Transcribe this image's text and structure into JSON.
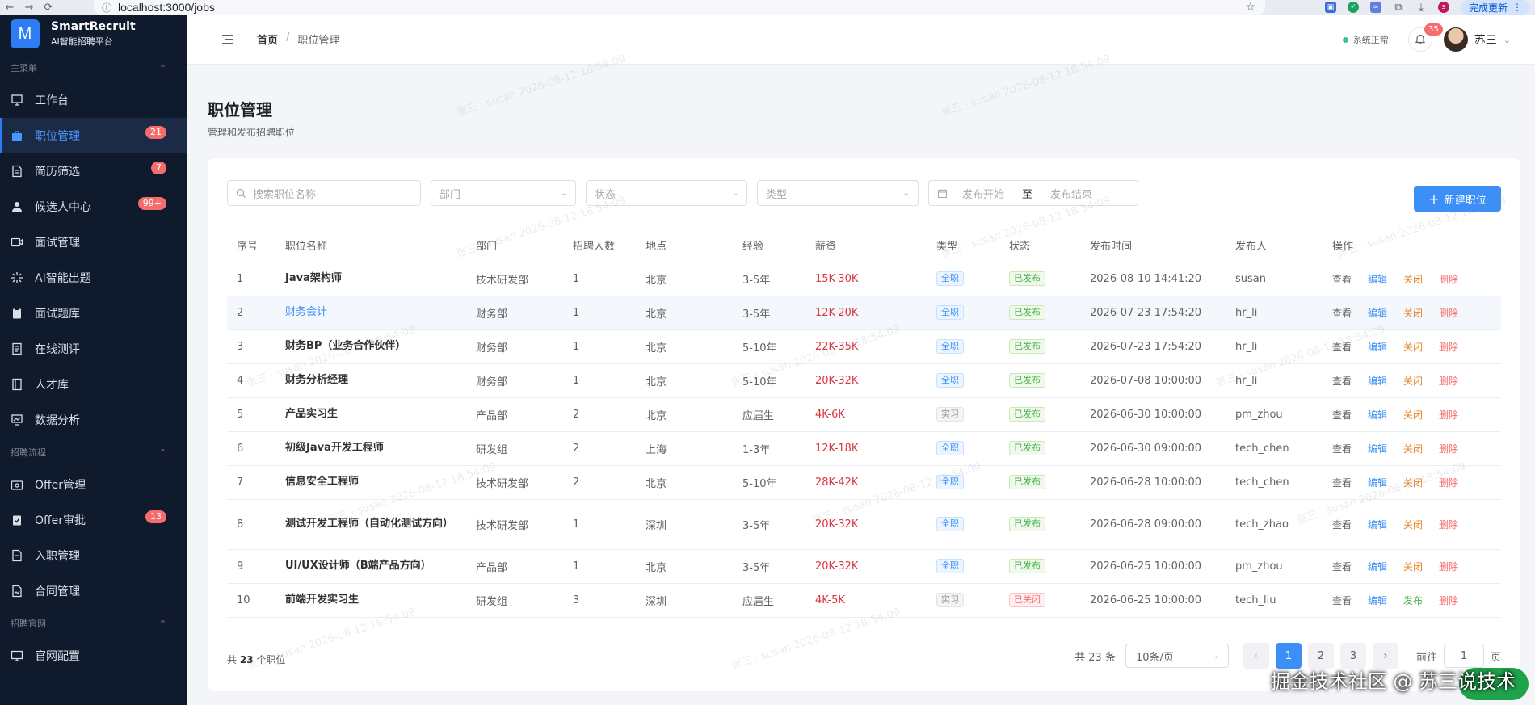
{
  "browser": {
    "url": "localhost:3000/jobs",
    "update_label": "完成更新",
    "profile_initial": "s"
  },
  "brand": {
    "name": "SmartRecruit",
    "subtitle": "AI智能招聘平台",
    "logo_letter": "M"
  },
  "sidebar": {
    "groups": [
      {
        "title": "主菜单",
        "items": [
          {
            "label": "工作台",
            "icon": "dashboard-icon"
          },
          {
            "label": "职位管理",
            "icon": "briefcase-icon",
            "badge": "21",
            "active": true
          },
          {
            "label": "简历筛选",
            "icon": "document-icon",
            "badge": "7"
          },
          {
            "label": "候选人中心",
            "icon": "user-icon",
            "badge": "99+"
          },
          {
            "label": "面试管理",
            "icon": "video-icon"
          },
          {
            "label": "AI智能出题",
            "icon": "sparkle-icon"
          },
          {
            "label": "面试题库",
            "icon": "clipboard-icon"
          },
          {
            "label": "在线测评",
            "icon": "test-icon"
          },
          {
            "label": "人才库",
            "icon": "book-icon"
          },
          {
            "label": "数据分析",
            "icon": "chart-icon"
          }
        ]
      },
      {
        "title": "招聘流程",
        "items": [
          {
            "label": "Offer管理",
            "icon": "offer-icon"
          },
          {
            "label": "Offer审批",
            "icon": "approve-icon",
            "badge": "13"
          },
          {
            "label": "入职管理",
            "icon": "onboard-icon"
          },
          {
            "label": "合同管理",
            "icon": "contract-icon"
          }
        ]
      },
      {
        "title": "招聘官网",
        "items": [
          {
            "label": "官网配置",
            "icon": "monitor-icon"
          }
        ]
      }
    ]
  },
  "header": {
    "breadcrumb_home": "首页",
    "breadcrumb_sep": "/",
    "breadcrumb_current": "职位管理",
    "system_status": "系统正常",
    "notification_count": "35",
    "user_name": "苏三"
  },
  "page": {
    "title": "职位管理",
    "subtitle": "管理和发布招聘职位"
  },
  "filters": {
    "search_placeholder": "搜索职位名称",
    "department_placeholder": "部门",
    "status_placeholder": "状态",
    "type_placeholder": "类型",
    "date_start": "发布开始",
    "date_sep": "至",
    "date_end": "发布结束",
    "new_button": "新建职位"
  },
  "table": {
    "columns": [
      "序号",
      "职位名称",
      "部门",
      "招聘人数",
      "地点",
      "经验",
      "薪资",
      "类型",
      "状态",
      "发布时间",
      "发布人",
      "操作"
    ],
    "rows": [
      {
        "no": "1",
        "name": "Java架构师",
        "dept": "技术研发部",
        "count": "1",
        "loc": "北京",
        "exp": "3-5年",
        "salary": "15K-30K",
        "type": "全职",
        "status": "已发布",
        "time": "2026-08-10 14:41:20",
        "publisher": "susan",
        "toggle": "关闭"
      },
      {
        "no": "2",
        "name": "财务会计",
        "dept": "财务部",
        "count": "1",
        "loc": "北京",
        "exp": "3-5年",
        "salary": "12K-20K",
        "type": "全职",
        "status": "已发布",
        "time": "2026-07-23 17:54:20",
        "publisher": "hr_li",
        "toggle": "关闭"
      },
      {
        "no": "3",
        "name": "财务BP（业务合作伙伴）",
        "dept": "财务部",
        "count": "1",
        "loc": "北京",
        "exp": "5-10年",
        "salary": "22K-35K",
        "type": "全职",
        "status": "已发布",
        "time": "2026-07-23 17:54:20",
        "publisher": "hr_li",
        "toggle": "关闭"
      },
      {
        "no": "4",
        "name": "财务分析经理",
        "dept": "财务部",
        "count": "1",
        "loc": "北京",
        "exp": "5-10年",
        "salary": "20K-32K",
        "type": "全职",
        "status": "已发布",
        "time": "2026-07-08 10:00:00",
        "publisher": "hr_li",
        "toggle": "关闭"
      },
      {
        "no": "5",
        "name": "产品实习生",
        "dept": "产品部",
        "count": "2",
        "loc": "北京",
        "exp": "应届生",
        "salary": "4K-6K",
        "type": "实习",
        "status": "已发布",
        "time": "2026-06-30 10:00:00",
        "publisher": "pm_zhou",
        "toggle": "关闭"
      },
      {
        "no": "6",
        "name": "初级Java开发工程师",
        "dept": "研发组",
        "count": "2",
        "loc": "上海",
        "exp": "1-3年",
        "salary": "12K-18K",
        "type": "全职",
        "status": "已发布",
        "time": "2026-06-30 09:00:00",
        "publisher": "tech_chen",
        "toggle": "关闭"
      },
      {
        "no": "7",
        "name": "信息安全工程师",
        "dept": "技术研发部",
        "count": "2",
        "loc": "北京",
        "exp": "5-10年",
        "salary": "28K-42K",
        "type": "全职",
        "status": "已发布",
        "time": "2026-06-28 10:00:00",
        "publisher": "tech_chen",
        "toggle": "关闭"
      },
      {
        "no": "8",
        "name": "测试开发工程师（自动化测试方向）",
        "dept": "技术研发部",
        "count": "1",
        "loc": "深圳",
        "exp": "3-5年",
        "salary": "20K-32K",
        "type": "全职",
        "status": "已发布",
        "time": "2026-06-28 09:00:00",
        "publisher": "tech_zhao",
        "toggle": "关闭"
      },
      {
        "no": "9",
        "name": "UI/UX设计师（B端产品方向）",
        "dept": "产品部",
        "count": "1",
        "loc": "北京",
        "exp": "3-5年",
        "salary": "20K-32K",
        "type": "全职",
        "status": "已发布",
        "time": "2026-06-25 10:00:00",
        "publisher": "pm_zhou",
        "toggle": "关闭"
      },
      {
        "no": "10",
        "name": "前端开发实习生",
        "dept": "研发组",
        "count": "3",
        "loc": "深圳",
        "exp": "应届生",
        "salary": "4K-5K",
        "type": "实习",
        "status": "已关闭",
        "time": "2026-06-25 10:00:00",
        "publisher": "tech_liu",
        "toggle": "发布"
      }
    ],
    "actions": {
      "view": "查看",
      "edit": "编辑",
      "delete": "删除"
    }
  },
  "footer": {
    "total_prefix": "共",
    "total_count": "23",
    "total_suffix": "个职位",
    "pager_total": "共 23 条",
    "page_size": "10条/页",
    "pages": [
      "1",
      "2",
      "3"
    ],
    "current_page": "1",
    "jump_label": "前往",
    "jump_value": "1",
    "jump_suffix": "页"
  },
  "watermark": {
    "text": "张三 · susan 2026-08-12 18:54:09",
    "corner_text": "掘金技术社区 @ 苏三说技术"
  },
  "colors": {
    "accent": "#3b8ff6",
    "sidebar_bg": "#0f1a2c",
    "salary": "#d9363e",
    "badge": "#f56c6c"
  }
}
